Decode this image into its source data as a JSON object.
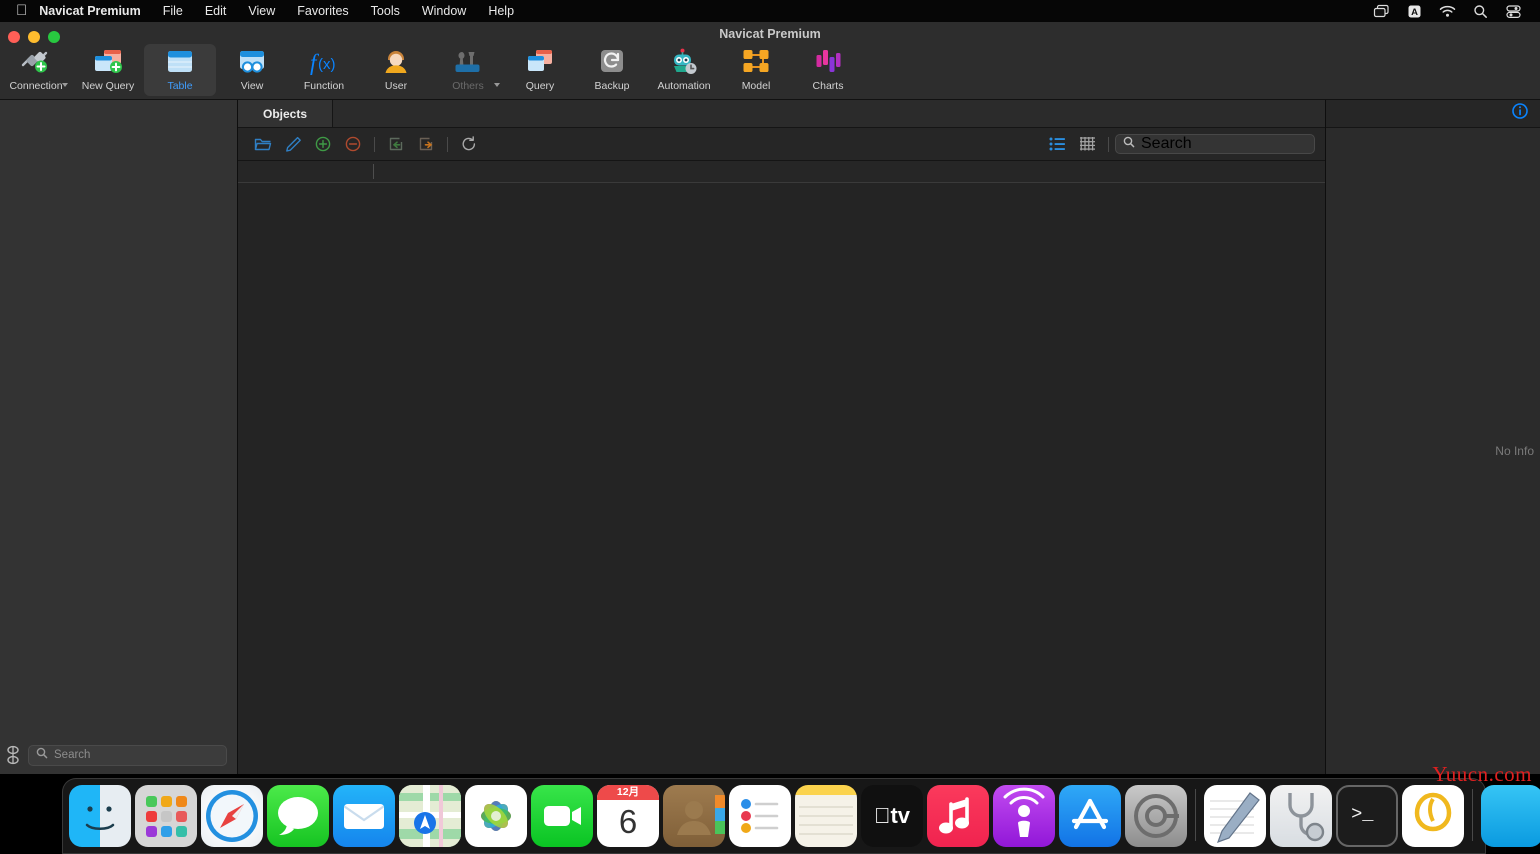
{
  "menubar": {
    "apple_icon": "apple-logo",
    "items": [
      {
        "label": "Navicat Premium",
        "bold": true
      },
      {
        "label": "File",
        "bold": false
      },
      {
        "label": "Edit",
        "bold": false
      },
      {
        "label": "View",
        "bold": false
      },
      {
        "label": "Favorites",
        "bold": false
      },
      {
        "label": "Tools",
        "bold": false
      },
      {
        "label": "Window",
        "bold": false
      },
      {
        "label": "Help",
        "bold": false
      }
    ],
    "status_icons": [
      {
        "name": "screen-mirroring-icon"
      },
      {
        "name": "input-source-icon",
        "label": "A"
      },
      {
        "name": "wifi-icon"
      },
      {
        "name": "spotlight-search-icon"
      },
      {
        "name": "control-center-icon"
      }
    ]
  },
  "window": {
    "title": "Navicat Premium",
    "traffic_lights": [
      {
        "name": "close-button",
        "color": "#ff5f57"
      },
      {
        "name": "minimize-button",
        "color": "#febc2e"
      },
      {
        "name": "maximize-button",
        "color": "#28c840"
      }
    ]
  },
  "toolbar": {
    "accent_color": "#3f9dfd",
    "items": [
      {
        "label": "Connection",
        "icon": "connection-icon",
        "selected": false,
        "disabled": false,
        "chevron": true
      },
      {
        "label": "New Query",
        "icon": "new-query-icon",
        "selected": false,
        "disabled": false,
        "chevron": false
      },
      {
        "label": "Table",
        "icon": "table-icon",
        "selected": true,
        "disabled": false,
        "chevron": false
      },
      {
        "label": "View",
        "icon": "view-icon",
        "selected": false,
        "disabled": false,
        "chevron": false
      },
      {
        "label": "Function",
        "icon": "function-icon",
        "selected": false,
        "disabled": false,
        "chevron": false
      },
      {
        "label": "User",
        "icon": "user-icon",
        "selected": false,
        "disabled": false,
        "chevron": false
      },
      {
        "label": "Others",
        "icon": "others-icon",
        "selected": false,
        "disabled": true,
        "chevron": true
      },
      {
        "label": "Query",
        "icon": "query-icon",
        "selected": false,
        "disabled": false,
        "chevron": false
      },
      {
        "label": "Backup",
        "icon": "backup-icon",
        "selected": false,
        "disabled": false,
        "chevron": false
      },
      {
        "label": "Automation",
        "icon": "automation-icon",
        "selected": false,
        "disabled": false,
        "chevron": false
      },
      {
        "label": "Model",
        "icon": "model-icon",
        "selected": false,
        "disabled": false,
        "chevron": false
      },
      {
        "label": "Charts",
        "icon": "charts-icon",
        "selected": false,
        "disabled": false,
        "chevron": false
      }
    ]
  },
  "sidebar": {
    "search": {
      "placeholder": "Search",
      "value": ""
    },
    "connection_icon": "connection-status-icon"
  },
  "center": {
    "tabs": [
      {
        "label": "Objects",
        "active": true
      }
    ],
    "object_toolbar": {
      "buttons": [
        {
          "name": "open-table-button",
          "icon": "folder-open-icon"
        },
        {
          "name": "design-table-button",
          "icon": "pencil-icon"
        },
        {
          "name": "new-table-button",
          "icon": "plus-circle-icon"
        },
        {
          "name": "delete-table-button",
          "icon": "minus-circle-icon"
        },
        {
          "name": "import-wizard-button",
          "icon": "import-arrow-icon"
        },
        {
          "name": "export-wizard-button",
          "icon": "export-arrow-icon"
        },
        {
          "name": "refresh-button",
          "icon": "refresh-icon"
        }
      ],
      "view_list": {
        "name": "list-view-toggle",
        "icon": "list-view-icon",
        "active": true
      },
      "view_grid": {
        "name": "grid-view-toggle",
        "icon": "grid-view-icon",
        "active": false
      },
      "search": {
        "placeholder": "Search",
        "value": ""
      }
    },
    "column_headers": [],
    "rows": []
  },
  "right_panel": {
    "info_icon": "info-circle-icon",
    "empty_text": "No Info"
  },
  "dock": {
    "items": [
      {
        "name": "dock-finder",
        "label": "Finder",
        "cls": "ic-finder"
      },
      {
        "name": "dock-launchpad",
        "label": "Launchpad",
        "cls": "ic-launchpad"
      },
      {
        "name": "dock-safari",
        "label": "Safari",
        "cls": "ic-safari"
      },
      {
        "name": "dock-messages",
        "label": "Messages",
        "cls": "ic-messages"
      },
      {
        "name": "dock-mail",
        "label": "Mail",
        "cls": "ic-mail"
      },
      {
        "name": "dock-maps",
        "label": "Maps",
        "cls": "ic-maps"
      },
      {
        "name": "dock-photos",
        "label": "Photos",
        "cls": "ic-photos"
      },
      {
        "name": "dock-facetime",
        "label": "FaceTime",
        "cls": "ic-facetime"
      },
      {
        "name": "dock-calendar",
        "label": "Calendar",
        "cls": "ic-calendar"
      },
      {
        "name": "dock-contacts",
        "label": "Contacts",
        "cls": "ic-contacts"
      },
      {
        "name": "dock-reminders",
        "label": "Reminders",
        "cls": "ic-reminders"
      },
      {
        "name": "dock-notes",
        "label": "Notes",
        "cls": "ic-notes"
      },
      {
        "name": "dock-appletv",
        "label": "Apple TV",
        "cls": "ic-appletv"
      },
      {
        "name": "dock-music",
        "label": "Music",
        "cls": "ic-music"
      },
      {
        "name": "dock-podcasts",
        "label": "Podcasts",
        "cls": "ic-podcasts"
      },
      {
        "name": "dock-appstore",
        "label": "App Store",
        "cls": "ic-appstore"
      },
      {
        "name": "dock-settings",
        "label": "System Settings",
        "cls": "ic-settings"
      },
      {
        "name": "dock-textedit",
        "label": "TextEdit",
        "cls": "ic-textedit"
      },
      {
        "name": "dock-activity-monitor",
        "label": "Activity Monitor",
        "cls": "ic-activity"
      },
      {
        "name": "dock-terminal",
        "label": "Terminal",
        "cls": "ic-terminal"
      },
      {
        "name": "dock-navicat",
        "label": "Navicat Premium",
        "cls": "ic-navicat"
      },
      {
        "name": "dock-blue-app",
        "label": "",
        "cls": "ic-blue"
      }
    ],
    "calendar": {
      "month": "12月",
      "day": "6"
    },
    "appletv_label": "tv"
  },
  "watermark": {
    "text": "Yuucn.com",
    "color": "#e02020"
  }
}
